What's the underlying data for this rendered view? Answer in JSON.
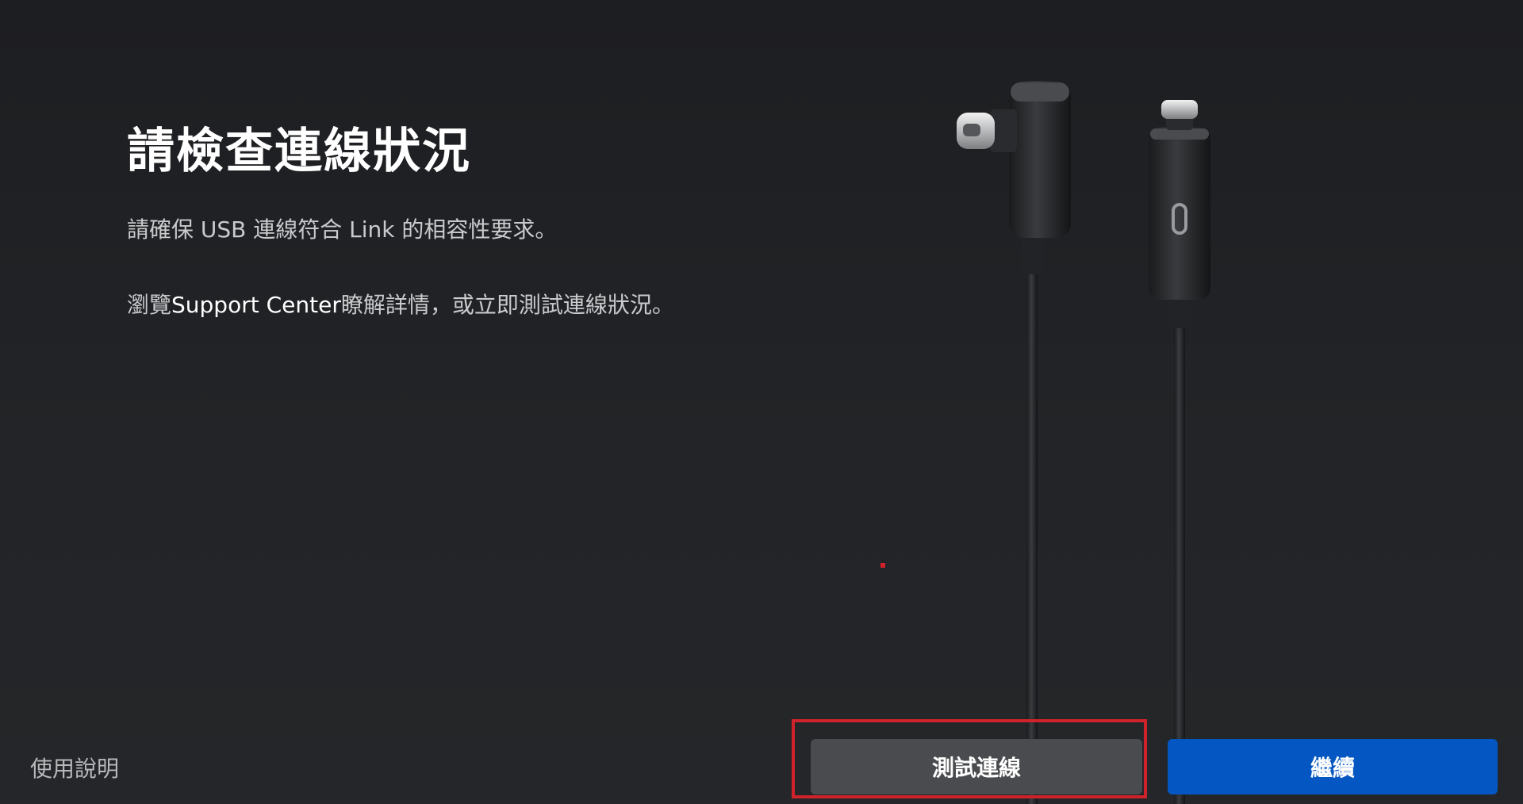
{
  "page": {
    "title": "請檢查連線狀況",
    "description": "請確保 USB 連線符合 Link 的相容性要求。",
    "support_prefix": "瀏覽",
    "support_link": "Support Center",
    "support_suffix": "瞭解詳情，或立即測試連線狀況。"
  },
  "footer": {
    "help_label": "使用說明",
    "test_button_label": "測試連線",
    "continue_button_label": "繼續"
  },
  "colors": {
    "background": "#1f2023",
    "continue_button": "#0457c2",
    "test_button": "#4a4b4e",
    "highlight": "#d0222a"
  },
  "icons": {
    "hero_image": "usb-c-cable-illustration"
  }
}
